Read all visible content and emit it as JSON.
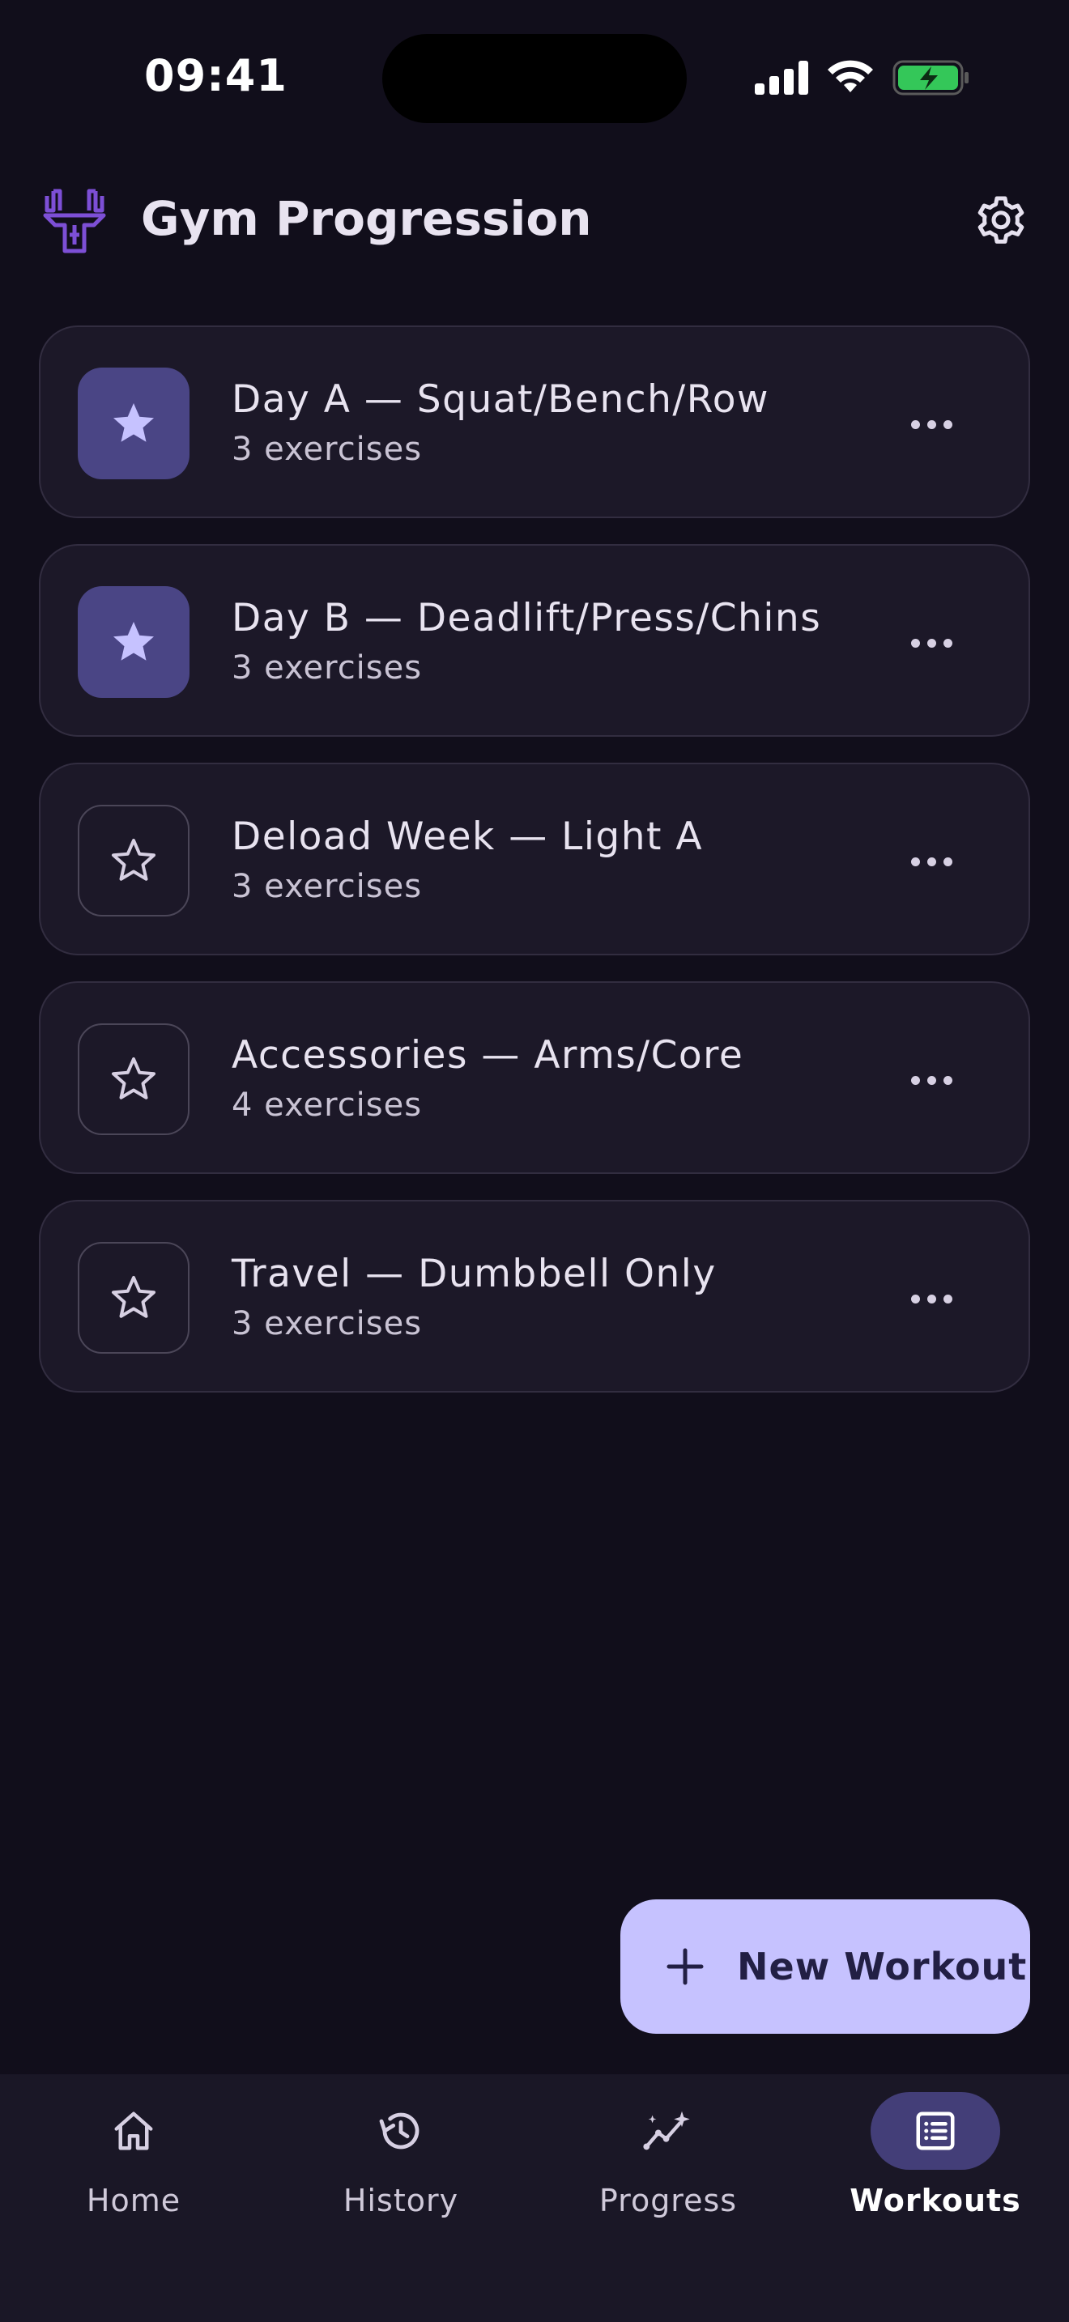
{
  "status_bar": {
    "time": "09:41"
  },
  "header": {
    "title": "Gym Progression"
  },
  "workouts": [
    {
      "title": "Day A — Squat/Bench/Row",
      "subtitle": "3 exercises",
      "favorite": true
    },
    {
      "title": "Day B — Deadlift/Press/Chins",
      "subtitle": "3 exercises",
      "favorite": true
    },
    {
      "title": "Deload Week — Light A",
      "subtitle": "3 exercises",
      "favorite": false
    },
    {
      "title": "Accessories — Arms/Core",
      "subtitle": "4 exercises",
      "favorite": false
    },
    {
      "title": "Travel — Dumbbell Only",
      "subtitle": "3 exercises",
      "favorite": false
    }
  ],
  "fab": {
    "label": "New Workout",
    "icon": "plus-icon"
  },
  "nav": {
    "items": [
      {
        "label": "Home",
        "icon": "home-icon"
      },
      {
        "label": "History",
        "icon": "history-icon"
      },
      {
        "label": "Progress",
        "icon": "progress-icon"
      },
      {
        "label": "Workouts",
        "icon": "list-icon",
        "active": true
      }
    ]
  },
  "colors": {
    "background": "#110e1b",
    "card": "#1c1828",
    "accent": "#c6c2ff",
    "favorite_tile": "#4a4585",
    "nav_active": "#433e78",
    "logo": "#7d4fd6",
    "battery": "#34c759"
  }
}
